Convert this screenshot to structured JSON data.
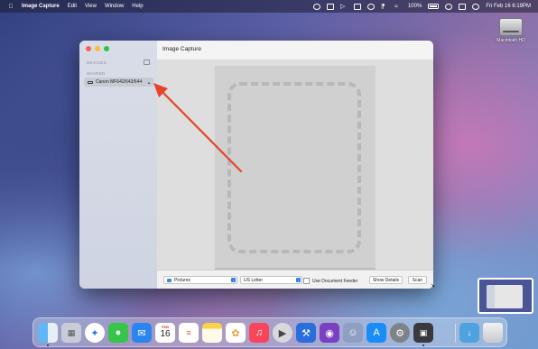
{
  "menubar": {
    "app_name": "Image Capture",
    "items": [
      "Edit",
      "View",
      "Window",
      "Help"
    ],
    "battery": "100%",
    "datetime": "Fri Feb 16  6:19PM"
  },
  "desktop": {
    "hd_label": "Macintosh HD"
  },
  "window": {
    "title": "Image Capture",
    "sidebar": {
      "devices_header": "DEVICES",
      "shared_header": "SHARED",
      "device_name": "Canon MF642/643/644"
    },
    "bottom": {
      "folder": "Pictures",
      "paper_size": "US Letter",
      "feeder_label": "Use Document Feeder",
      "details_button": "Show Details",
      "scan_button": "Scan"
    }
  },
  "dock": {
    "calendar_month": "FEB",
    "calendar_day": "16",
    "apps": [
      "finder",
      "launchpad",
      "safari",
      "messages",
      "mail",
      "calendar",
      "reminders",
      "notes",
      "photos",
      "music",
      "quicktime",
      "xcode",
      "github-desktop",
      "steam-helper",
      "app-store",
      "system-settings",
      "image-capture",
      "downloads",
      "trash"
    ]
  },
  "annotation": {
    "arrow_color": "#e8432b"
  }
}
